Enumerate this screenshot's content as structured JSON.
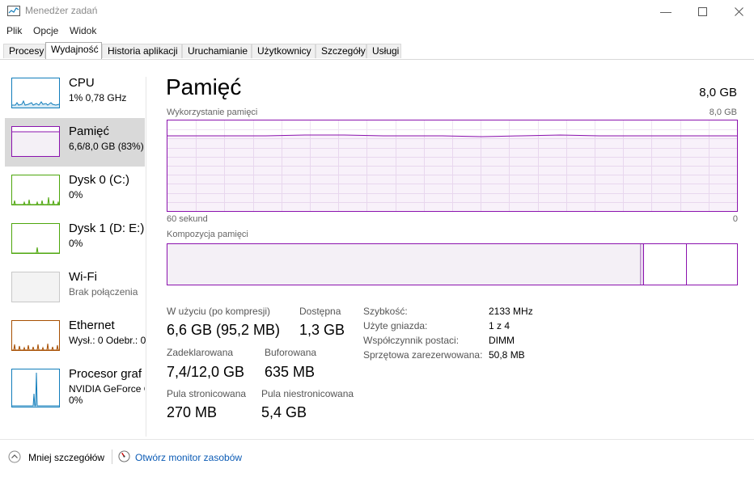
{
  "window": {
    "title": "Menedżer zadań"
  },
  "menu": [
    "Plik",
    "Opcje",
    "Widok"
  ],
  "tabs": [
    "Procesy",
    "Wydajność",
    "Historia aplikacji",
    "Uruchamianie",
    "Użytkownicy",
    "Szczegóły",
    "Usługi"
  ],
  "active_tab": "Wydajność",
  "sidebar": {
    "items": [
      {
        "title": "CPU",
        "subtitle": "1% 0,78 GHz",
        "color": "#117dbb"
      },
      {
        "title": "Pamięć",
        "subtitle": "6,6/8,0 GB (83%)",
        "color": "#8b12ae"
      },
      {
        "title": "Dysk 0 (C:)",
        "subtitle": "0%",
        "color": "#4da60c"
      },
      {
        "title": "Dysk 1 (D: E:)",
        "subtitle": "0%",
        "color": "#4da60c"
      },
      {
        "title": "Wi-Fi",
        "subtitle": "Brak połączenia",
        "color": "#c8c8c8"
      },
      {
        "title": "Ethernet",
        "subtitle": "Wysł.: 0 Odebr.: 0",
        "color": "#a74f01"
      },
      {
        "title": "Procesor graf",
        "subtitle": "NVIDIA GeForce G",
        "subtitle2": "0%",
        "color": "#117dbb"
      }
    ]
  },
  "main": {
    "title": "Pamięć",
    "total": "8,0 GB",
    "usage_label": "Wykorzystanie pamięci",
    "usage_max": "8,0 GB",
    "time_left": "60 sekund",
    "time_right": "0",
    "usage_fraction": 0.83,
    "composition_label": "Kompozycja pamięci",
    "composition": {
      "in_use_fraction": 0.83,
      "modified_fraction": 0.005,
      "standby_fraction": 0.075,
      "free_fraction": 0.09
    },
    "stats": {
      "in_use_label": "W użyciu (po kompresji)",
      "in_use_value": "6,6 GB (95,2 MB)",
      "available_label": "Dostępna",
      "available_value": "1,3 GB",
      "committed_label": "Zadeklarowana",
      "committed_value": "7,4/12,0 GB",
      "cached_label": "Buforowana",
      "cached_value": "635 MB",
      "paged_label": "Pula stronicowana",
      "paged_value": "270 MB",
      "nonpaged_label": "Pula niestronicowana",
      "nonpaged_value": "5,4 GB"
    },
    "details": [
      {
        "key": "Szybkość:",
        "value": "2133 MHz"
      },
      {
        "key": "Użyte gniazda:",
        "value": "1 z 4"
      },
      {
        "key": "Współczynnik postaci:",
        "value": "DIMM"
      },
      {
        "key": "Sprzętowa zarezerwowana:",
        "value": "50,8 MB"
      }
    ]
  },
  "footer": {
    "less_details": "Mniej szczegółów",
    "open_monitor": "Otwórz monitor zasobów"
  }
}
